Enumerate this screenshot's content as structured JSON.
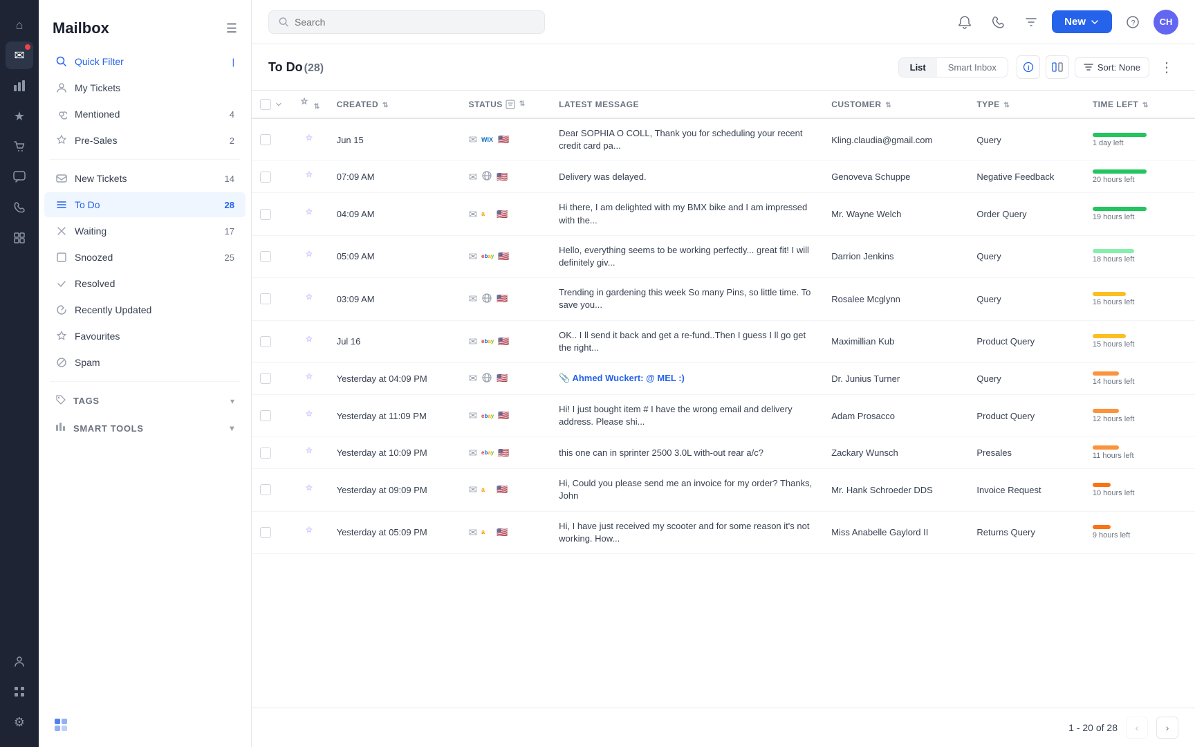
{
  "app": {
    "title": "Mailbox"
  },
  "topbar": {
    "search_placeholder": "Search",
    "new_label": "New",
    "avatar_initials": "CH"
  },
  "sidebar": {
    "items": [
      {
        "id": "quick-filter",
        "label": "Quick Filter",
        "icon": "🔍",
        "count": "",
        "active": false,
        "special": "quick-filter"
      },
      {
        "id": "my-tickets",
        "label": "My Tickets",
        "icon": "👤",
        "count": ""
      },
      {
        "id": "mentioned",
        "label": "Mentioned",
        "icon": "🏷",
        "count": "4"
      },
      {
        "id": "pre-sales",
        "label": "Pre-Sales",
        "icon": "🎁",
        "count": "2"
      },
      {
        "id": "new-tickets",
        "label": "New Tickets",
        "icon": "✉",
        "count": "14"
      },
      {
        "id": "to-do",
        "label": "To Do",
        "icon": "☰",
        "count": "28",
        "active": true
      },
      {
        "id": "waiting",
        "label": "Waiting",
        "icon": "✕",
        "count": "17"
      },
      {
        "id": "snoozed",
        "label": "Snoozed",
        "icon": "□",
        "count": "25"
      },
      {
        "id": "resolved",
        "label": "Resolved",
        "icon": "✓",
        "count": ""
      },
      {
        "id": "recently-updated",
        "label": "Recently Updated",
        "icon": "⟳",
        "count": ""
      },
      {
        "id": "favourites",
        "label": "Favourites",
        "icon": "★",
        "count": ""
      },
      {
        "id": "spam",
        "label": "Spam",
        "icon": "⊘",
        "count": ""
      }
    ],
    "tags_label": "TAGS",
    "smart_tools_label": "SMART TOOLS"
  },
  "tickets": {
    "title": "To Do",
    "count": "(28)",
    "view_list": "List",
    "view_smart": "Smart Inbox",
    "sort_label": "Sort: None",
    "columns": [
      {
        "key": "magic",
        "label": ""
      },
      {
        "key": "created",
        "label": "Created"
      },
      {
        "key": "status",
        "label": "Status"
      },
      {
        "key": "message",
        "label": "Latest message"
      },
      {
        "key": "customer",
        "label": "Customer"
      },
      {
        "key": "type",
        "label": "Type"
      },
      {
        "key": "time_left",
        "label": "Time left"
      }
    ],
    "rows": [
      {
        "created": "Jun 15",
        "message": "Dear SOPHIA O COLL, Thank you for scheduling your recent credit card pa...",
        "customer": "Kling.claudia@gmail.com",
        "type": "Query",
        "time_left": "1 day left",
        "bar_class": "bar-green",
        "bar_width": "75",
        "channel": "wix",
        "flag": "🇺🇸"
      },
      {
        "created": "07:09 AM",
        "message": "Delivery was delayed.",
        "customer": "Genoveva Schuppe",
        "type": "Negative Feedback",
        "time_left": "20 hours left",
        "bar_class": "bar-green",
        "bar_width": "68",
        "channel": "globe",
        "flag": "🇺🇸"
      },
      {
        "created": "04:09 AM",
        "message": "Hi there, I am delighted with my BMX bike and I am impressed with the...",
        "customer": "Mr. Wayne Welch",
        "type": "Order Query",
        "time_left": "19 hours left",
        "bar_class": "bar-green",
        "bar_width": "62",
        "channel": "amazon",
        "flag": "🇺🇸"
      },
      {
        "created": "05:09 AM",
        "message": "Hello, everything seems to be working perfectly... great fit! I will definitely giv...",
        "customer": "Darrion Jenkins",
        "type": "Query",
        "time_left": "18 hours left",
        "bar_class": "bar-green-med",
        "bar_width": "58",
        "channel": "ebay",
        "flag": "🇺🇸"
      },
      {
        "created": "03:09 AM",
        "message": "Trending in gardening this week So many Pins, so little time. To save you...",
        "customer": "Rosalee Mcglynn",
        "type": "Query",
        "time_left": "16 hours left",
        "bar_class": "bar-yellow",
        "bar_width": "50",
        "channel": "globe",
        "flag": "🇺🇸"
      },
      {
        "created": "Jul 16",
        "message": "OK.. I ll send it back and get a re-fund..Then I guess I ll go get the right...",
        "customer": "Maximillian Kub",
        "type": "Product Query",
        "time_left": "15 hours left",
        "bar_class": "bar-yellow",
        "bar_width": "46",
        "channel": "ebay",
        "flag": "🇺🇸"
      },
      {
        "created": "Yesterday at 04:09 PM",
        "message": "Ahmed Wuckert: @ MEL :)",
        "customer": "Dr. Junius Turner",
        "type": "Query",
        "time_left": "14 hours left",
        "bar_class": "bar-orange",
        "bar_width": "42",
        "channel": "globe",
        "flag": "🇺🇸",
        "message_bold": true
      },
      {
        "created": "Yesterday at 11:09 PM",
        "message": "Hi! I just bought item # I have the wrong email and delivery address. Please shi...",
        "customer": "Adam Prosacco",
        "type": "Product Query",
        "time_left": "12 hours left",
        "bar_class": "bar-orange",
        "bar_width": "36",
        "channel": "ebay",
        "flag": "🇺🇸"
      },
      {
        "created": "Yesterday at 10:09 PM",
        "message": "this one can in sprinter 2500 3.0L with-out rear a/c?",
        "customer": "Zackary Wunsch",
        "type": "Presales",
        "time_left": "11 hours left",
        "bar_class": "bar-orange",
        "bar_width": "32",
        "channel": "ebay",
        "flag": "🇺🇸"
      },
      {
        "created": "Yesterday at 09:09 PM",
        "message": "Hi, Could you please send me an invoice for my order? Thanks, John",
        "customer": "Mr. Hank Schroeder DDS",
        "type": "Invoice Request",
        "time_left": "10 hours left",
        "bar_class": "bar-red-orange",
        "bar_width": "28",
        "channel": "amazon",
        "flag": "🇺🇸"
      },
      {
        "created": "Yesterday at 05:09 PM",
        "message": "Hi, I have just received my scooter and for some reason it's not working. How...",
        "customer": "Miss Anabelle Gaylord II",
        "type": "Returns Query",
        "time_left": "9 hours left",
        "bar_class": "bar-red-orange",
        "bar_width": "24",
        "channel": "amazon",
        "flag": "🇺🇸"
      }
    ]
  },
  "pagination": {
    "info": "1 - 20 of 28",
    "label": "20 of 28"
  },
  "rail": {
    "icons": [
      {
        "name": "home",
        "symbol": "⌂",
        "active": false
      },
      {
        "name": "mail",
        "symbol": "✉",
        "active": true
      },
      {
        "name": "chart",
        "symbol": "📊",
        "active": false
      },
      {
        "name": "star",
        "symbol": "★",
        "active": false
      },
      {
        "name": "cart",
        "symbol": "🛒",
        "active": false
      },
      {
        "name": "chat",
        "symbol": "💬",
        "active": false
      },
      {
        "name": "phone",
        "symbol": "📞",
        "active": false
      },
      {
        "name": "puzzle",
        "symbol": "🧩",
        "active": false
      },
      {
        "name": "team",
        "symbol": "👥",
        "active": false
      },
      {
        "name": "apps",
        "symbol": "⚏",
        "active": false
      },
      {
        "name": "settings",
        "symbol": "⚙",
        "active": false
      }
    ]
  }
}
